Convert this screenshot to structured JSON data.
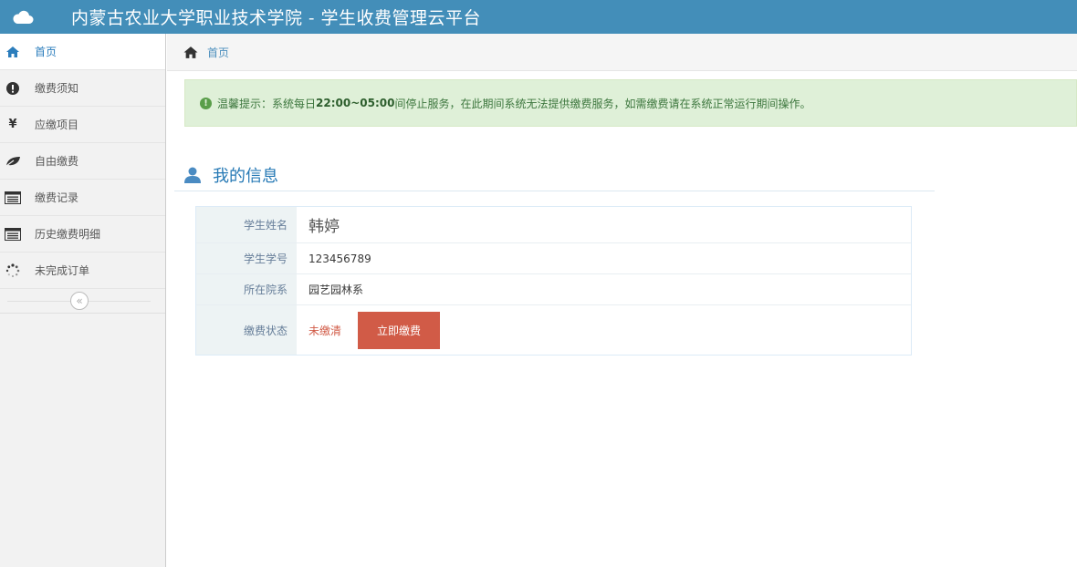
{
  "navbar": {
    "title": "内蒙古农业大学职业技术学院 - 学生收费管理云平台",
    "logo_icon": "cloud-icon",
    "bg_color": "#438eb9"
  },
  "sidebar": {
    "items": [
      {
        "label": "首页",
        "icon": "home-icon",
        "active": true
      },
      {
        "label": "缴费须知",
        "icon": "exclamation-icon"
      },
      {
        "label": "应缴项目",
        "icon": "yen-icon"
      },
      {
        "label": "自由缴费",
        "icon": "leaf-icon"
      },
      {
        "label": "缴费记录",
        "icon": "list-icon"
      },
      {
        "label": "历史缴费明细",
        "icon": "list-icon"
      },
      {
        "label": "未完成订单",
        "icon": "spinner-icon"
      }
    ],
    "collapse_icon": "double-chevron-left-icon"
  },
  "breadcrumb": {
    "home_icon": "home-icon",
    "current": "首页"
  },
  "alert": {
    "prefix": "温馨提示：系统每日",
    "time": "22:00~05:00",
    "suffix": "间停止服务，在此期间系统无法提供缴费服务，如需缴费请在系统正常运行期间操作。",
    "icon": "check-circle-icon"
  },
  "profile": {
    "title": "我的信息",
    "icon": "user-icon",
    "rows": [
      {
        "label": "学生姓名",
        "value": "韩婷"
      },
      {
        "label": "学生学号",
        "value": "123456789"
      },
      {
        "label": "所在院系",
        "value": "园艺园林系"
      },
      {
        "label": "缴费状态",
        "value": "未缴清"
      }
    ],
    "pay_button": "立即缴费",
    "status_color": "#d15b47"
  }
}
